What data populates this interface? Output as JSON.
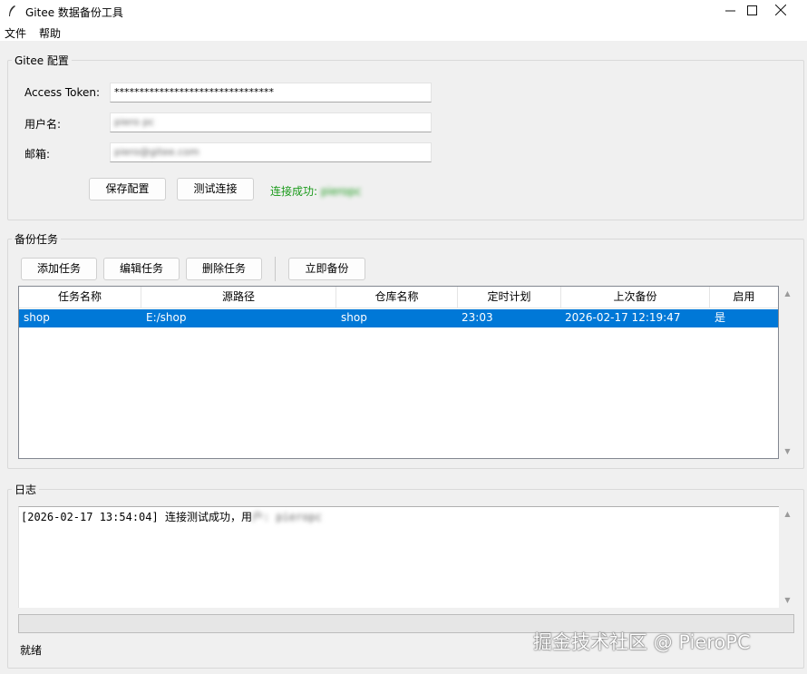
{
  "window": {
    "title": "Gitee 数据备份工具",
    "icon": "feather-icon",
    "controls": [
      "minimize-icon",
      "maximize-icon",
      "close-icon"
    ]
  },
  "menu": {
    "file": "文件",
    "help": "帮助"
  },
  "config": {
    "legend": "Gitee 配置",
    "token_label": "Access Token:",
    "token_value": "********************************",
    "username_label": "用户名:",
    "username_value": "piero pc",
    "email_label": "邮箱:",
    "email_value": "piero@gitee.com",
    "save_button": "保存配置",
    "test_button": "测试连接",
    "status_text": "连接成功:",
    "status_user": "pieropc",
    "status_color": "#1a9a1a"
  },
  "tasks": {
    "legend": "备份任务",
    "add_button": "添加任务",
    "edit_button": "编辑任务",
    "delete_button": "删除任务",
    "backup_now_button": "立即备份",
    "columns": [
      "任务名称",
      "源路径",
      "仓库名称",
      "定时计划",
      "上次备份",
      "启用"
    ],
    "rows": [
      {
        "name": "shop",
        "source": "E:/shop",
        "repo": "shop",
        "schedule": "23:03",
        "last_backup": "2026-02-17 12:19:47",
        "enabled": "是"
      }
    ],
    "selection_color": "#0078d7"
  },
  "log": {
    "legend": "日志",
    "line1": "[2026-02-17 13:54:04] 连接测试成功，用",
    "line1_hidden": "户: pieropc"
  },
  "statusbar": {
    "text": "就绪"
  },
  "watermark": "掘金技术社区 @ PieroPC"
}
